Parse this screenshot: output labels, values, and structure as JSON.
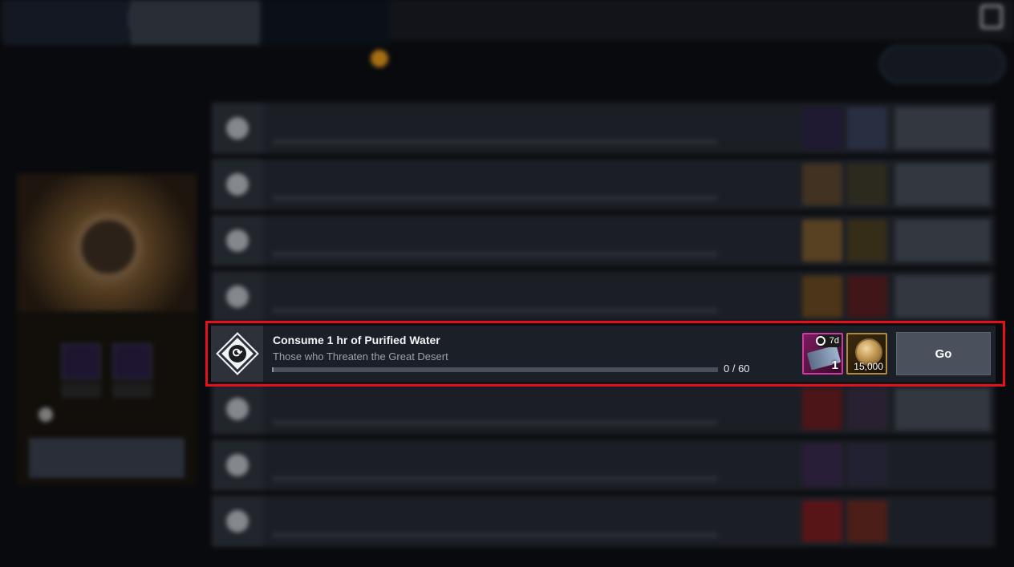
{
  "focus_task": {
    "title": "Consume 1 hr of Purified Water",
    "subtitle": "Those who Threaten the Great Desert",
    "progress_text": "0 / 60",
    "progress_fraction": 0.0,
    "reward_1": {
      "icon": "ticket-icon",
      "duration_tag": "7d",
      "quantity": "1"
    },
    "reward_2": {
      "icon": "silver-coin-icon",
      "quantity": "15,000"
    },
    "go_label": "Go"
  },
  "colors": {
    "highlight_frame": "#e4101c",
    "reward_1_border": "#d03aa0",
    "reward_2_border": "#b08a3a"
  }
}
